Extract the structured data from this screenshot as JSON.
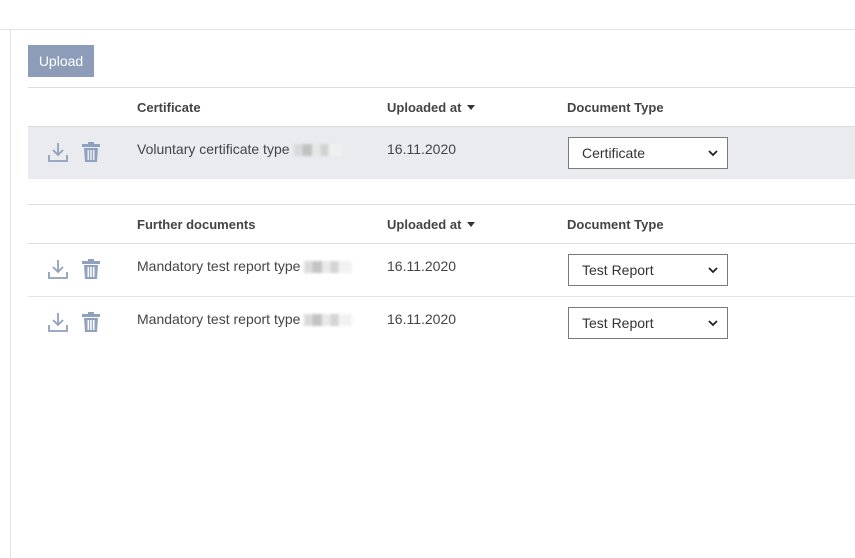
{
  "toolbar": {
    "upload_label": "Upload"
  },
  "certificate_table": {
    "headers": {
      "name": "Certificate",
      "uploaded_at": "Uploaded at",
      "document_type": "Document Type"
    },
    "rows": [
      {
        "name": "Voluntary certificate type",
        "date": "16.11.2020",
        "type": "Certificate"
      }
    ]
  },
  "further_table": {
    "headers": {
      "name": "Further documents",
      "uploaded_at": "Uploaded at",
      "document_type": "Document Type"
    },
    "rows": [
      {
        "name": "Mandatory test report type",
        "date": "16.11.2020",
        "type": "Test Report"
      },
      {
        "name": "Mandatory test report type",
        "date": "16.11.2020",
        "type": "Test Report"
      }
    ]
  },
  "icons": {
    "download": "download-icon",
    "delete": "trash-icon",
    "sort": "sort-desc-icon",
    "select": "chevron-down-icon"
  },
  "colors": {
    "button_bg": "#8d9db9",
    "icon": "#8fa1bf",
    "highlight_row": "#e9ebef"
  }
}
